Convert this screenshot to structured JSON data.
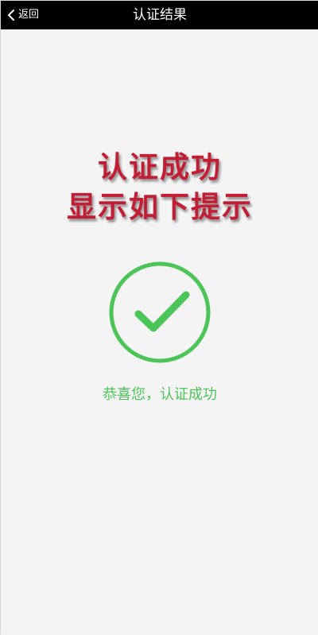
{
  "topbar": {
    "back_label": "返回",
    "back_icon": "chevron-left-icon",
    "title": "认证结果"
  },
  "overlay": {
    "line1": "认证成功",
    "line2": "显示如下提示"
  },
  "result": {
    "icon": "checkmark-circle-icon",
    "message": "恭喜您，认证成功"
  },
  "colors": {
    "topbar_bg": "#000000",
    "page_bg": "#f4f4f4",
    "overlay_text": "#c31d34",
    "success_green": "#4bc458"
  }
}
